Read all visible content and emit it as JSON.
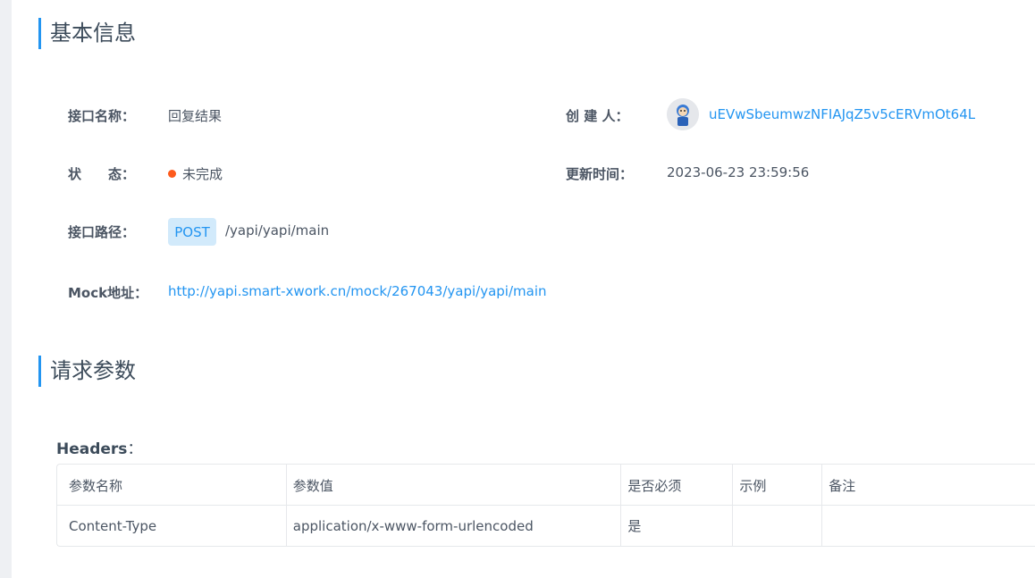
{
  "colors": {
    "accent": "#2395f1",
    "status_incomplete": "#fd5a1c",
    "method_bg": "#d2eafb",
    "method_text": "#2395f1"
  },
  "basic_info": {
    "title": "基本信息",
    "name_label": "接口名称：",
    "name_value": "回复结果",
    "creator_label": "创 建 人：",
    "creator_name": "uEVwSbeumwzNFIAJqZ5v5cERVmOt64L",
    "status_label": "状　　态：",
    "status_value": "未完成",
    "updated_label": "更新时间：",
    "updated_value": "2023-06-23 23:59:56",
    "path_label": "接口路径：",
    "method": "POST",
    "path_value": "/yapi/yapi/main",
    "mock_label": "Mock地址：",
    "mock_url": "http://yapi.smart-xwork.cn/mock/267043/yapi/yapi/main"
  },
  "request_params": {
    "title": "请求参数",
    "headers_title": "Headers",
    "headers_colon": "：",
    "columns": [
      "参数名称",
      "参数值",
      "是否必须",
      "示例",
      "备注"
    ],
    "rows": [
      [
        "Content-Type",
        "application/x-www-form-urlencoded",
        "是",
        "",
        ""
      ]
    ]
  }
}
